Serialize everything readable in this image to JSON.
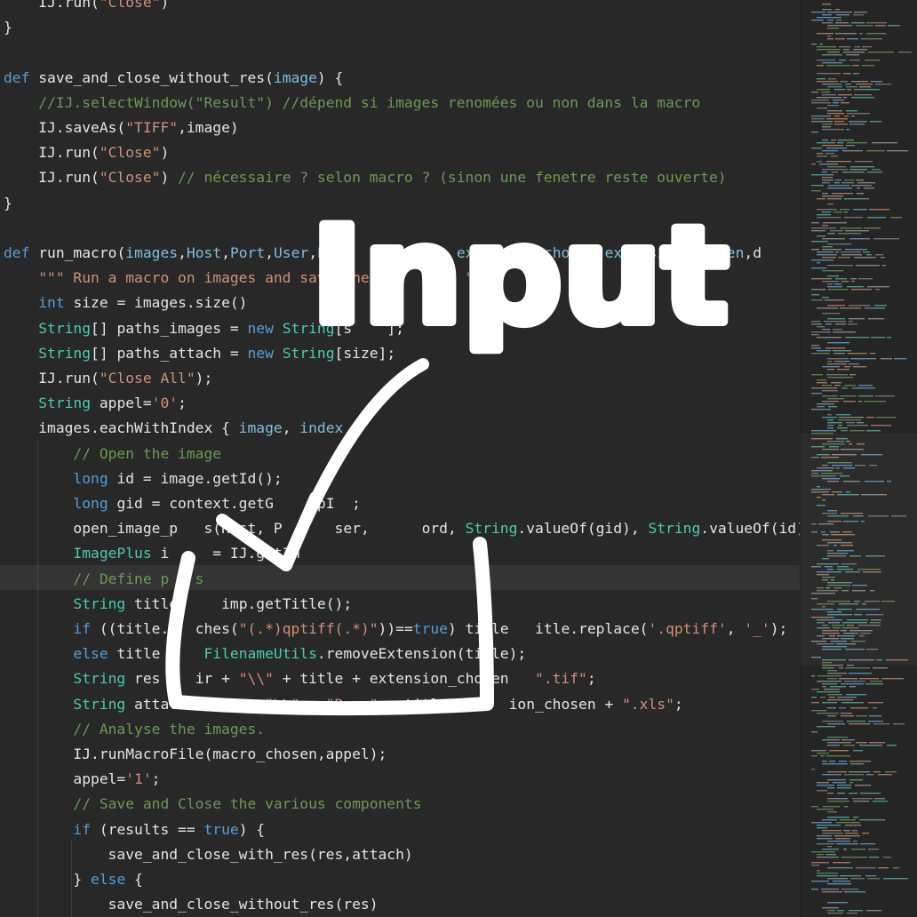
{
  "editor": {
    "lines": [
      [
        [
          "plain",
          "    IJ.run("
        ],
        [
          "str",
          "\"Close\""
        ],
        [
          "plain",
          ")"
        ]
      ],
      [
        [
          "plain",
          "}"
        ]
      ],
      [],
      [
        [
          "kw",
          "def "
        ],
        [
          "fn",
          "save_and_close_without_res"
        ],
        [
          "plain",
          "("
        ],
        [
          "par",
          "image"
        ],
        [
          "plain",
          ") {"
        ]
      ],
      [
        [
          "plain",
          "    "
        ],
        [
          "cmt",
          "//IJ.selectWindow(\"Result\") //dépend si images renomées ou non dans la macro"
        ]
      ],
      [
        [
          "plain",
          "    IJ.saveAs("
        ],
        [
          "str",
          "\"TIFF\""
        ],
        [
          "plain",
          ",image)"
        ]
      ],
      [
        [
          "plain",
          "    IJ.run("
        ],
        [
          "str",
          "\"Close\""
        ],
        [
          "plain",
          ")"
        ]
      ],
      [
        [
          "plain",
          "    IJ.run("
        ],
        [
          "str",
          "\"Close\""
        ],
        [
          "plain",
          ") "
        ],
        [
          "cmt",
          "// nécessaire ? selon macro ? (sinon une fenetre reste ouverte)"
        ]
      ],
      [
        [
          "plain",
          "}"
        ]
      ],
      [],
      [
        [
          "kw",
          "def "
        ],
        [
          "fn",
          "run_macro"
        ],
        [
          "plain",
          "("
        ],
        [
          "par",
          "images"
        ],
        [
          "plain",
          ","
        ],
        [
          "par",
          "Host"
        ],
        [
          "plain",
          ","
        ],
        [
          "par",
          "Port"
        ],
        [
          "plain",
          ","
        ],
        [
          "par",
          "User"
        ],
        [
          "plain",
          ","
        ],
        [
          "par",
          "Pas"
        ],
        [
          "plain",
          "             "
        ],
        [
          "par",
          "ext"
        ],
        [
          "plain",
          ","
        ],
        [
          "par",
          "ma"
        ],
        [
          "plain",
          "    "
        ],
        [
          "par",
          "chosen"
        ],
        [
          "plain",
          ","
        ],
        [
          "par",
          "extension_chosen"
        ],
        [
          "plain",
          ",d         "
        ],
        [
          "plain",
          "){"
        ]
      ],
      [
        [
          "plain",
          "    "
        ],
        [
          "str",
          "\"\"\" Run a macro on images and save the "
        ],
        [
          "plain",
          "     "
        ],
        [
          "str",
          "sult \"\"\""
        ]
      ],
      [
        [
          "plain",
          "    "
        ],
        [
          "kw",
          "int"
        ],
        [
          "plain",
          " size = images.size()"
        ]
      ],
      [
        [
          "plain",
          "    "
        ],
        [
          "type",
          "String"
        ],
        [
          "plain",
          "[] paths_images = "
        ],
        [
          "kw",
          "new "
        ],
        [
          "type",
          "String"
        ],
        [
          "plain",
          "[s"
        ],
        [
          "plain",
          "    ];"
        ]
      ],
      [
        [
          "plain",
          "    "
        ],
        [
          "type",
          "String"
        ],
        [
          "plain",
          "[] paths_attach = "
        ],
        [
          "kw",
          "new "
        ],
        [
          "type",
          "String"
        ],
        [
          "plain",
          "[size];"
        ]
      ],
      [
        [
          "plain",
          "    IJ.run("
        ],
        [
          "str",
          "\"Close All\""
        ],
        [
          "plain",
          ");"
        ]
      ],
      [
        [
          "plain",
          "    "
        ],
        [
          "type",
          "String"
        ],
        [
          "plain",
          " appel="
        ],
        [
          "str",
          "'0'"
        ],
        [
          "plain",
          ";"
        ]
      ],
      [
        [
          "plain",
          "    images.eachWithIndex { "
        ],
        [
          "par",
          "image"
        ],
        [
          "plain",
          ", "
        ],
        [
          "par",
          "index"
        ],
        [
          "plain",
          " -"
        ]
      ],
      [
        [
          "plain",
          "        "
        ],
        [
          "cmt",
          "// Open the image"
        ]
      ],
      [
        [
          "plain",
          "        "
        ],
        [
          "kw",
          "long"
        ],
        [
          "plain",
          " id = image.getId();"
        ]
      ],
      [
        [
          "plain",
          "        "
        ],
        [
          "kw",
          "long"
        ],
        [
          "plain",
          " gid = context.getG"
        ],
        [
          "plain",
          "     "
        ],
        [
          "plain",
          "pI"
        ],
        [
          "plain",
          "  ;"
        ]
      ],
      [
        [
          "plain",
          "        open_image_p"
        ],
        [
          "plain",
          "   "
        ],
        [
          "plain",
          "s(Host, P"
        ],
        [
          "plain",
          "      "
        ],
        [
          "plain",
          "ser, "
        ],
        [
          "plain",
          "     "
        ],
        [
          "plain",
          "ord, "
        ],
        [
          "type",
          "String"
        ],
        [
          "plain",
          ".valueOf(gid), "
        ],
        [
          "type",
          "String"
        ],
        [
          "plain",
          ".valueOf(id));"
        ]
      ],
      [
        [
          "plain",
          "        "
        ],
        [
          "type",
          "ImagePlus"
        ],
        [
          "plain",
          " i"
        ],
        [
          "plain",
          "     "
        ],
        [
          "plain",
          "= IJ.getIm"
        ]
      ],
      [
        [
          "plain",
          "        "
        ],
        [
          "cmt",
          "// Define p"
        ],
        [
          "cmt",
          "   "
        ],
        [
          "cmt",
          "s"
        ]
      ],
      [
        [
          "plain",
          "        "
        ],
        [
          "type",
          "String"
        ],
        [
          "plain",
          " title"
        ],
        [
          "plain",
          "    "
        ],
        [
          "plain",
          " imp.getTitle();"
        ]
      ],
      [
        [
          "plain",
          "        "
        ],
        [
          "kw",
          "if"
        ],
        [
          "plain",
          " ((title."
        ],
        [
          "plain",
          "   "
        ],
        [
          "plain",
          "ches("
        ],
        [
          "str",
          "\"(.*)qptiff(.*)\""
        ],
        [
          "plain",
          "))=="
        ],
        [
          "kw",
          "true"
        ],
        [
          "plain",
          ") title"
        ],
        [
          "plain",
          "   "
        ],
        [
          "plain",
          "itle.replace("
        ],
        [
          "str",
          "'.qptiff'"
        ],
        [
          "plain",
          ", "
        ],
        [
          "str",
          "'_'"
        ],
        [
          "plain",
          ");"
        ]
      ],
      [
        [
          "plain",
          "        "
        ],
        [
          "kw",
          "else"
        ],
        [
          "plain",
          " title "
        ],
        [
          "plain",
          "    "
        ],
        [
          "type",
          "FilenameUtils"
        ],
        [
          "plain",
          ".removeExtension(title);"
        ]
      ],
      [
        [
          "plain",
          "        "
        ],
        [
          "type",
          "String"
        ],
        [
          "plain",
          " res "
        ],
        [
          "plain",
          "   "
        ],
        [
          "plain",
          "ir + "
        ],
        [
          "str",
          "\"\\\\\""
        ],
        [
          "plain",
          " + title + extension_chosen"
        ],
        [
          "plain",
          "   "
        ],
        [
          "str",
          "\".tif\""
        ],
        [
          "plain",
          ";"
        ]
      ],
      [
        [
          "plain",
          "        "
        ],
        [
          "type",
          "String"
        ],
        [
          "plain",
          " attach"
        ],
        [
          "plain",
          "    "
        ],
        [
          "plain",
          "ir + "
        ],
        [
          "str",
          "\"\\\\\""
        ],
        [
          "plain",
          " + "
        ],
        [
          "str",
          "\"Res_\""
        ],
        [
          "plain",
          " + title + "
        ],
        [
          "plain",
          "    "
        ],
        [
          "plain",
          "ion_chosen + "
        ],
        [
          "str",
          "\".xls\""
        ],
        [
          "plain",
          ";"
        ]
      ],
      [
        [
          "plain",
          "        "
        ],
        [
          "cmt",
          "// Analyse the images."
        ]
      ],
      [
        [
          "plain",
          "        IJ.runMacroFile(macro_chosen,appel);"
        ]
      ],
      [
        [
          "plain",
          "        appel="
        ],
        [
          "str",
          "'1'"
        ],
        [
          "plain",
          ";"
        ]
      ],
      [
        [
          "plain",
          "        "
        ],
        [
          "cmt",
          "// Save and Close the various components"
        ]
      ],
      [
        [
          "plain",
          "        "
        ],
        [
          "kw",
          "if"
        ],
        [
          "plain",
          " (results == "
        ],
        [
          "kw",
          "true"
        ],
        [
          "plain",
          ") {"
        ]
      ],
      [
        [
          "plain",
          "            save_and_close_with_res(res,attach)"
        ]
      ],
      [
        [
          "plain",
          "        } "
        ],
        [
          "kw",
          "else"
        ],
        [
          "plain",
          " {"
        ]
      ],
      [
        [
          "plain",
          "            save_and_close_without_res(res)"
        ]
      ]
    ]
  },
  "overlay": {
    "handwritten_text": "Input",
    "arrow_icon": "arrow-down-left-icon",
    "bracket_icon": "drop-zone-bracket-icon",
    "ink_color": "#ffffff"
  },
  "theme": {
    "background": "#282828",
    "keyword": "#569cd6",
    "string": "#ce9178",
    "comment": "#6a9955",
    "type": "#4ec9b0",
    "parameter": "#7fbde0"
  }
}
